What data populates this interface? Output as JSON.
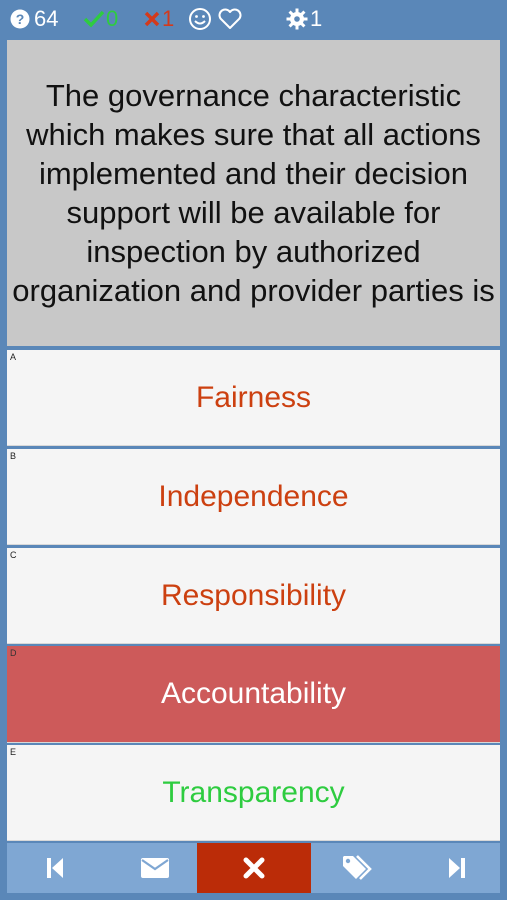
{
  "status": {
    "question_count": "64",
    "correct_count": "0",
    "wrong_count": "1",
    "gear_count": "1"
  },
  "question": {
    "text": "The governance characteristic which makes sure that all actions implemented and their decision support will be available for inspection by authorized organization and provider parties is"
  },
  "answers": [
    {
      "letter": "A",
      "text": "Fairness",
      "state": "normal"
    },
    {
      "letter": "B",
      "text": "Independence",
      "state": "normal"
    },
    {
      "letter": "C",
      "text": "Responsibility",
      "state": "normal"
    },
    {
      "letter": "D",
      "text": "Accountability",
      "state": "selected-wrong"
    },
    {
      "letter": "E",
      "text": "Transparency",
      "state": "correct"
    }
  ],
  "colors": {
    "background": "#5a87b8",
    "question_bg": "#c8c8c8",
    "answer_text": "#cc4010",
    "correct_green": "#2ecc40",
    "wrong_red": "#cd5a5a",
    "close_button": "#bb2c08",
    "bottom_bar": "#7fa7d3"
  },
  "icons": {
    "question": "question-circle-icon",
    "correct": "check-icon",
    "wrong": "x-icon",
    "smile": "smile-icon",
    "heart": "heart-icon",
    "gear": "gear-icon",
    "prev": "skip-back-icon",
    "mail": "envelope-icon",
    "close": "close-icon",
    "tags": "tags-icon",
    "next": "skip-forward-icon"
  }
}
